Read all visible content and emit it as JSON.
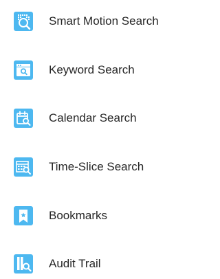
{
  "menu": {
    "items": [
      {
        "label": "Smart Motion Search",
        "icon": "smart-motion-search-icon"
      },
      {
        "label": "Keyword Search",
        "icon": "keyword-search-icon"
      },
      {
        "label": "Calendar Search",
        "icon": "calendar-search-icon"
      },
      {
        "label": "Time-Slice Search",
        "icon": "time-slice-search-icon"
      },
      {
        "label": "Bookmarks",
        "icon": "bookmark-icon"
      },
      {
        "label": "Audit Trail",
        "icon": "audit-trail-icon"
      }
    ]
  },
  "colors": {
    "icon_background": "#4db8f0",
    "icon_foreground": "#ffffff",
    "label_text": "#262626"
  }
}
